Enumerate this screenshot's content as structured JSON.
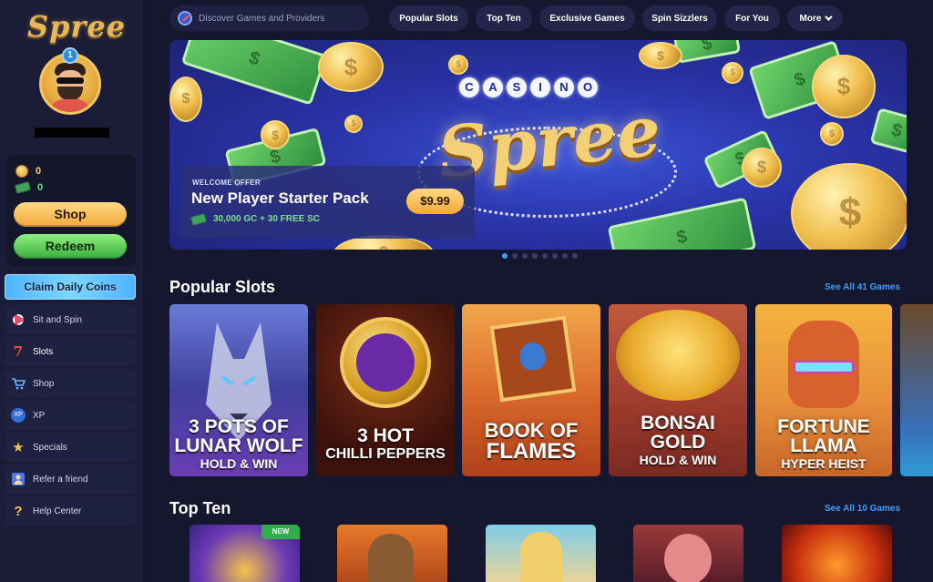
{
  "brand": {
    "logo_text": "Spree"
  },
  "user": {
    "level": "1"
  },
  "wallet": {
    "gold_coins": "0",
    "sweeps_coins": "0"
  },
  "buttons": {
    "shop": "Shop",
    "redeem": "Redeem",
    "claim_daily": "Claim Daily Coins"
  },
  "sidebar": {
    "items": [
      {
        "label": "Sit and Spin",
        "icon": "poker-chip-icon"
      },
      {
        "label": "Slots",
        "icon": "slot-seven-icon"
      },
      {
        "label": "Shop",
        "icon": "cart-icon"
      },
      {
        "label": "XP",
        "icon": "xp-badge-icon"
      },
      {
        "label": "Specials",
        "icon": "star-icon"
      },
      {
        "label": "Refer a friend",
        "icon": "refer-friend-icon"
      },
      {
        "label": "Help Center",
        "icon": "question-icon"
      }
    ]
  },
  "topbar": {
    "search_placeholder": "Discover Games and Providers",
    "tabs": [
      "Popular Slots",
      "Top Ten",
      "Exclusive Games",
      "Spin Sizzlers",
      "For You",
      "More"
    ]
  },
  "hero": {
    "casino_word": [
      "C",
      "A",
      "S",
      "I",
      "N",
      "O"
    ],
    "brand_word": "Spree",
    "offer_tag": "WELCOME OFFER",
    "offer_title": "New Player Starter Pack",
    "offer_sub": "30,000 GC + 30 FREE SC",
    "price": "$9.99",
    "slides": 8,
    "active_slide": 1
  },
  "popular": {
    "title": "Popular Slots",
    "see_all": "See All 41 Games",
    "games": [
      {
        "line1": "3 POTS OF",
        "line2": "LUNAR WOLF",
        "line3": "HOLD & WIN"
      },
      {
        "line1": "3 HOT",
        "line2": "CHILLI PEPPERS",
        "line3": ""
      },
      {
        "line1": "BOOK OF",
        "line2": "FLAMES",
        "line3": ""
      },
      {
        "line1": "BONSAI",
        "line2": "GOLD",
        "line3": "HOLD & WIN"
      },
      {
        "line1": "FORTUNE",
        "line2": "LLAMA",
        "line3": "HYPER HEIST"
      }
    ]
  },
  "topten": {
    "title": "Top Ten",
    "see_all": "See All 10 Games",
    "new_badge": "NEW"
  },
  "colors": {
    "accent": "#3da0ff",
    "shop": "#f3a83a",
    "redeem": "#3aae3e",
    "bg": "#15172f"
  }
}
